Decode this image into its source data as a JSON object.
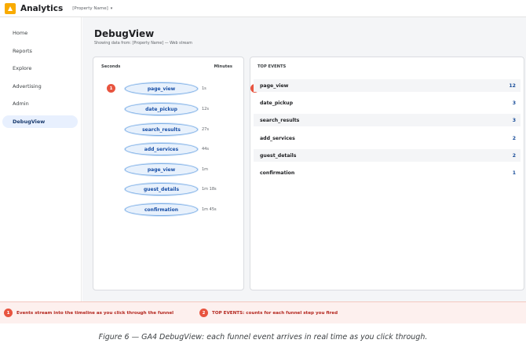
{
  "app": {
    "title": "Analytics",
    "property": "[Property Name]",
    "caret": "▾"
  },
  "sidebar": {
    "items": [
      {
        "label": "Home"
      },
      {
        "label": "Reports"
      },
      {
        "label": "Explore"
      },
      {
        "label": "Advertising"
      },
      {
        "label": "Admin"
      },
      {
        "label": "DebugView",
        "active": true
      }
    ]
  },
  "page": {
    "title": "DebugView",
    "subtitle": "Showing data from: [Property Name] — Web stream"
  },
  "timeline": {
    "col_seconds": "Seconds",
    "col_minutes": "Minutes",
    "events": [
      {
        "name": "page_view",
        "time": "1s"
      },
      {
        "name": "date_pickup",
        "time": "12s"
      },
      {
        "name": "search_results",
        "time": "27s"
      },
      {
        "name": "add_services",
        "time": "44s"
      },
      {
        "name": "page_view",
        "time": "1m"
      },
      {
        "name": "guest_details",
        "time": "1m 18s"
      },
      {
        "name": "confirmation",
        "time": "1m 45s"
      }
    ]
  },
  "top_events": {
    "header": "TOP EVENTS",
    "rows": [
      {
        "name": "page_view",
        "count": "12"
      },
      {
        "name": "date_pickup",
        "count": "3"
      },
      {
        "name": "search_results",
        "count": "3"
      },
      {
        "name": "add_services",
        "count": "2"
      },
      {
        "name": "guest_details",
        "count": "2"
      },
      {
        "name": "confirmation",
        "count": "1"
      }
    ]
  },
  "callouts": [
    {
      "num": "1",
      "text": "Events stream into the timeline as you click through the funnel"
    },
    {
      "num": "2",
      "text": "TOP EVENTS: counts for each funnel step you fired"
    }
  ],
  "caption": "Figure 6 — GA4 DebugView: each funnel event arrives in real time as you click through.",
  "colors": {
    "accent": "#f9ab00",
    "badge": "#e8543f",
    "pill_border": "#7fb0e6",
    "active_nav": "#e8f0fe"
  }
}
